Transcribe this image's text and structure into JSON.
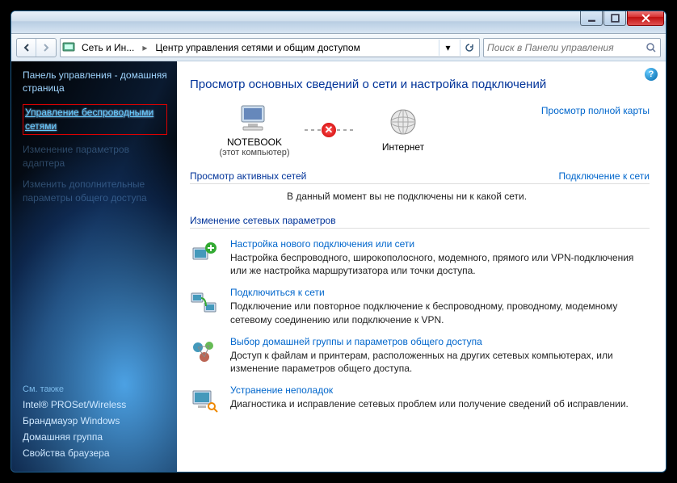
{
  "breadcrumb": {
    "seg1": "Сеть и Ин...",
    "seg2": "Центр управления сетями и общим доступом"
  },
  "search": {
    "placeholder": "Поиск в Панели управления"
  },
  "sidebar": {
    "home": "Панель управления - домашняя страница",
    "links": [
      "Управление беспроводными сетями",
      "Изменение параметров адаптера",
      "Изменить дополнительные параметры общего доступа"
    ],
    "seealso_hdr": "См. также",
    "seealso": [
      "Intel® PROSet/Wireless",
      "Брандмауэр Windows",
      "Домашняя группа",
      "Свойства браузера"
    ]
  },
  "main": {
    "title": "Просмотр основных сведений о сети и настройка подключений",
    "map_full": "Просмотр полной карты",
    "node1": {
      "label": "NOTEBOOK",
      "sub": "(этот компьютер)"
    },
    "node2": {
      "label": "Интернет"
    },
    "active_hdr": "Просмотр активных сетей",
    "active_link": "Подключение к сети",
    "active_msg": "В данный момент вы не подключены ни к какой сети.",
    "change_hdr": "Изменение сетевых параметров",
    "items": [
      {
        "title": "Настройка нового подключения или сети",
        "desc": "Настройка беспроводного, широкополосного, модемного, прямого или VPN-подключения или же настройка маршрутизатора или точки доступа."
      },
      {
        "title": "Подключиться к сети",
        "desc": "Подключение или повторное подключение к беспроводному, проводному, модемному сетевому соединению или подключение к VPN."
      },
      {
        "title": "Выбор домашней группы и параметров общего доступа",
        "desc": "Доступ к файлам и принтерам, расположенных на других сетевых компьютерах, или изменение параметров общего доступа."
      },
      {
        "title": "Устранение неполадок",
        "desc": "Диагностика и исправление сетевых проблем или получение сведений об исправлении."
      }
    ]
  }
}
